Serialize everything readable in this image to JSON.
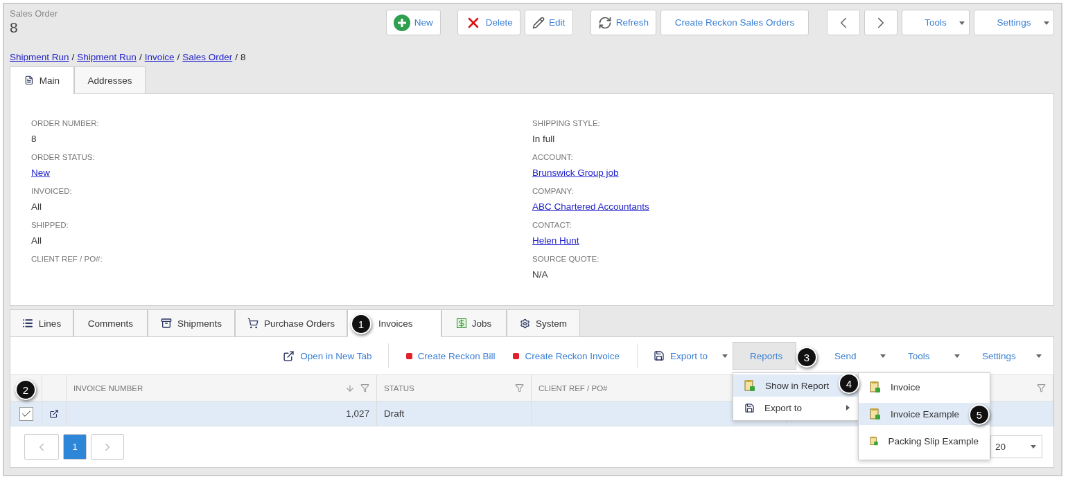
{
  "header": {
    "title": "Sales Order",
    "number": "8"
  },
  "toolbar": [
    {
      "kind": "button",
      "label": "New"
    },
    {
      "kind": "button",
      "label": "Delete"
    },
    {
      "kind": "button",
      "label": "Edit"
    },
    {
      "kind": "button",
      "label": "Refresh"
    },
    {
      "kind": "button",
      "label": "Create Reckon Sales Orders"
    },
    {
      "kind": "prev"
    },
    {
      "kind": "next"
    },
    {
      "kind": "dropdown",
      "label": "Tools"
    },
    {
      "kind": "dropdown",
      "label": "Settings"
    }
  ],
  "breadcrumb": [
    {
      "kind": "link",
      "label": "Shipment Run"
    },
    {
      "kind": "separator",
      "label": "/"
    },
    {
      "kind": "link",
      "label": "Shipment Run"
    },
    {
      "kind": "separator",
      "label": "/"
    },
    {
      "kind": "link",
      "label": "Invoice"
    },
    {
      "kind": "separator",
      "label": "/"
    },
    {
      "kind": "link",
      "label": "Sales Order"
    },
    {
      "kind": "separator",
      "label": "/"
    },
    {
      "kind": "current",
      "label": "8"
    }
  ],
  "tabs": [
    {
      "label": "Main",
      "selected": true
    },
    {
      "label": "Addresses",
      "selected": false
    }
  ],
  "fields_left": [
    {
      "label": "ORDER NUMBER:",
      "value": "8",
      "kind": "text"
    },
    {
      "label": "ORDER STATUS:",
      "value": "New",
      "kind": "link"
    },
    {
      "label": "INVOICED:",
      "value": "All",
      "kind": "text"
    },
    {
      "label": "SHIPPED:",
      "value": "All",
      "kind": "text"
    },
    {
      "label": "CLIENT REF / PO#:"
    }
  ],
  "fields_right": [
    {
      "label": "SHIPPING STYLE:",
      "value": "In full",
      "kind": "text"
    },
    {
      "label": "ACCOUNT:",
      "value": "Brunswick Group job",
      "kind": "link"
    },
    {
      "label": "COMPANY:",
      "value": "ABC Chartered Accountants",
      "kind": "link"
    },
    {
      "label": "CONTACT:",
      "value": "Helen Hunt",
      "kind": "link"
    },
    {
      "label": "SOURCE QUOTE:",
      "value": "N/A",
      "kind": "text"
    }
  ],
  "bottom_tabs": [
    {
      "label": "Lines",
      "selected": false
    },
    {
      "label": "Comments",
      "selected": false
    },
    {
      "label": "Shipments",
      "selected": false
    },
    {
      "label": "Purchase Orders",
      "selected": false
    },
    {
      "label": "Invoices",
      "selected": true
    },
    {
      "label": "Jobs",
      "selected": false
    },
    {
      "label": "System",
      "selected": false
    }
  ],
  "grid_toolbar": [
    {
      "kind": "link",
      "label": "Open in New Tab"
    },
    {
      "kind": "reckon",
      "label": "Create Reckon Bill"
    },
    {
      "kind": "reckon",
      "label": "Create Reckon Invoice"
    },
    {
      "kind": "dropdown",
      "label": "Export to",
      "open": false
    },
    {
      "kind": "dropdown",
      "label": "Reports",
      "open": true
    },
    {
      "kind": "dropdown",
      "label": "Send",
      "open": false
    },
    {
      "kind": "dropdown",
      "label": "Tools",
      "open": false
    },
    {
      "kind": "dropdown",
      "label": "Settings",
      "open": false
    }
  ],
  "table": {
    "columns": [
      {
        "label": "INVOICE NUMBER",
        "sorted": true
      },
      {
        "label": "STATUS",
        "sorted": false
      },
      {
        "label": "CLIENT REF / PO#",
        "sorted": false
      },
      {
        "sorted": false
      }
    ],
    "rows": [
      {
        "selected": true,
        "checked": true,
        "invoice_number": "1,027",
        "status": "Draft"
      }
    ]
  },
  "pagination": {
    "pages": [
      {
        "label": "1",
        "selected": true
      }
    ],
    "page_size": "20"
  },
  "menu": [
    {
      "label": "Show in Report",
      "selected": true,
      "submenu": true
    },
    {
      "label": "Export to",
      "selected": false,
      "submenu": true
    }
  ],
  "submenu": [
    {
      "label": "Invoice",
      "selected": false
    },
    {
      "label": "Invoice Example",
      "selected": true
    },
    {
      "label": "Packing Slip Example",
      "selected": false
    }
  ],
  "callouts": [
    "1",
    "2",
    "3",
    "4",
    "5"
  ]
}
